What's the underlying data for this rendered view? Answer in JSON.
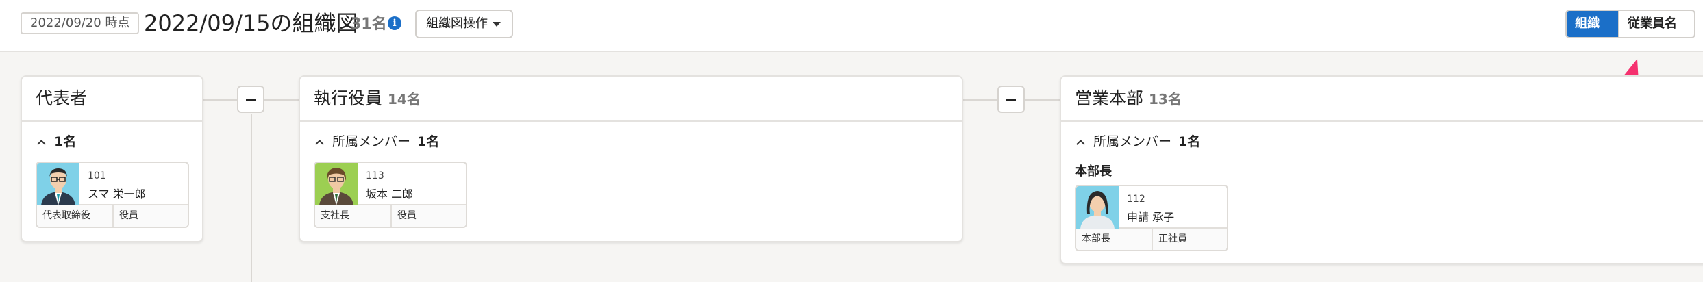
{
  "header": {
    "as_of_date": "2022/09/20 時点",
    "title": "2022/09/15の組織図",
    "member_count": "31名",
    "info_icon": "info-icon",
    "org_ops_label": "組織図操作",
    "view_org_chart": "組織図",
    "view_employee_list": "従業員名簿"
  },
  "colors": {
    "accent": "#1b6fc8",
    "arrow": "#f5316f",
    "background": "#f6f5f3"
  },
  "org": {
    "representative": {
      "title": "代表者",
      "section_count": "1名",
      "employee": {
        "id": "101",
        "name": "スマ 栄一郎",
        "tag1": "代表取締役",
        "tag2": "役員"
      }
    },
    "executives": {
      "title": "執行役員",
      "count": "14名",
      "section_label": "所属メンバー",
      "section_count": "1名",
      "employee": {
        "id": "113",
        "name": "坂本 二郎",
        "tag1": "支社長",
        "tag2": "役員"
      }
    },
    "sales": {
      "title": "営業本部",
      "count": "13名",
      "section_label": "所属メンバー",
      "section_count": "1名",
      "role_label": "本部長",
      "employee": {
        "id": "112",
        "name": "申請 承子",
        "tag1": "本部長",
        "tag2": "正社員"
      }
    }
  }
}
